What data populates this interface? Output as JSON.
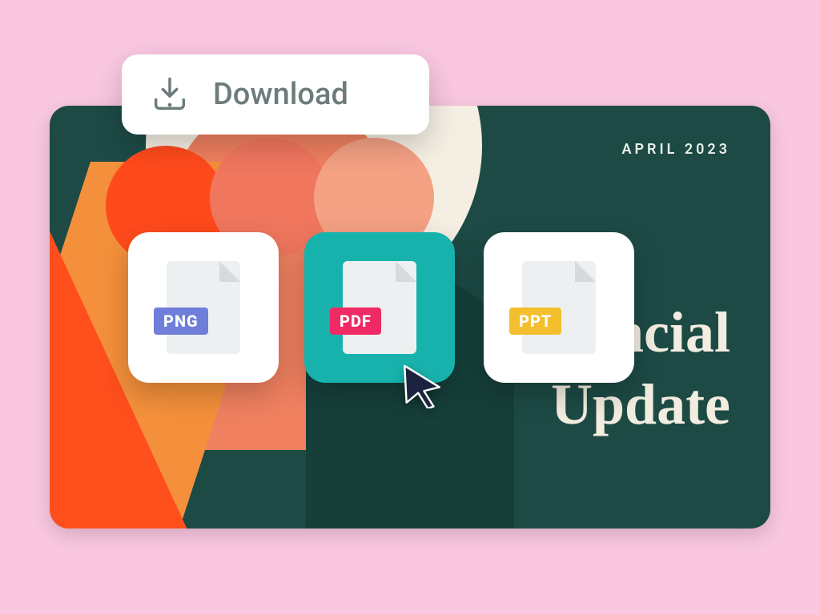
{
  "download": {
    "label": "Download"
  },
  "slide": {
    "date": "APRIL 2023",
    "title_line1": "Financial",
    "title_line2": "Update"
  },
  "formats": {
    "png": "PNG",
    "pdf": "PDF",
    "ppt": "PPT"
  }
}
